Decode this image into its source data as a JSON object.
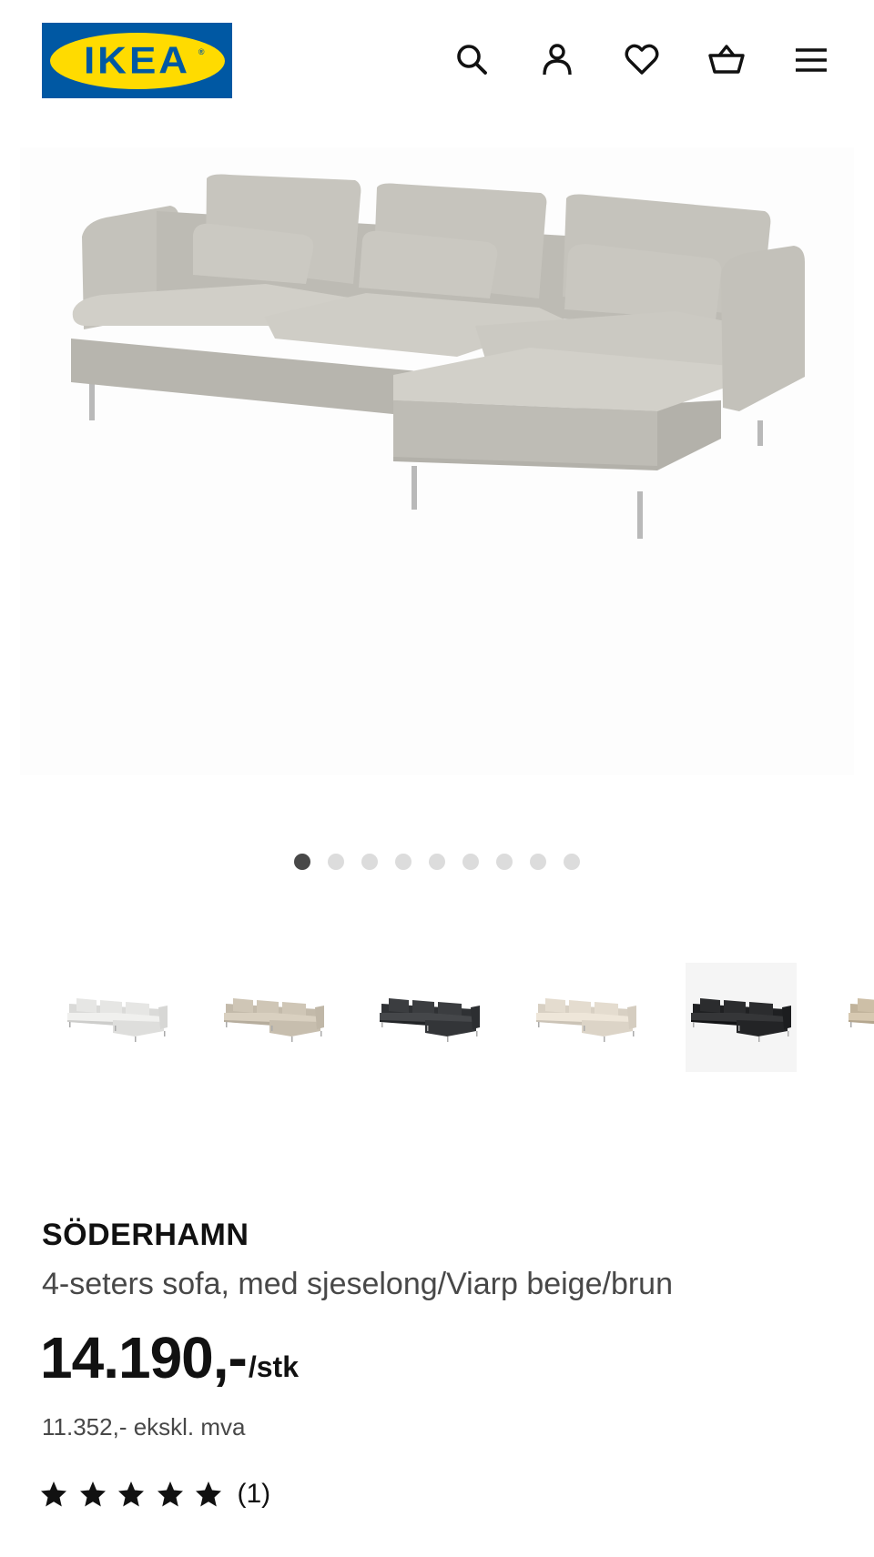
{
  "header": {
    "logo_text": "IKEA",
    "icons": [
      "search-icon",
      "account-icon",
      "heart-icon",
      "basket-icon",
      "menu-icon"
    ]
  },
  "gallery": {
    "image_count": 9,
    "active_index": 0
  },
  "variants": {
    "count": 6,
    "selected_index": 4,
    "colors": [
      "#e6e6e4",
      "#cfc6b6",
      "#3b3d40",
      "#e4dccf",
      "#2b2c2e",
      "#cdbfa7"
    ]
  },
  "product": {
    "name": "SÖDERHAMN",
    "description": "4-seters sofa, med sjeselong/Viarp beige/brun",
    "price": "14.190,-",
    "price_unit": "/stk",
    "price_ex_vat": "11.352,- ekskl. mva",
    "rating": 5,
    "review_count": "(1)"
  },
  "colors": {
    "ikea_blue": "#0058a3",
    "ikea_yellow": "#ffdb00",
    "sofa_fabric": "#c2c0b9",
    "dot_active": "#484848",
    "dot_inactive": "#dcdcdc"
  }
}
